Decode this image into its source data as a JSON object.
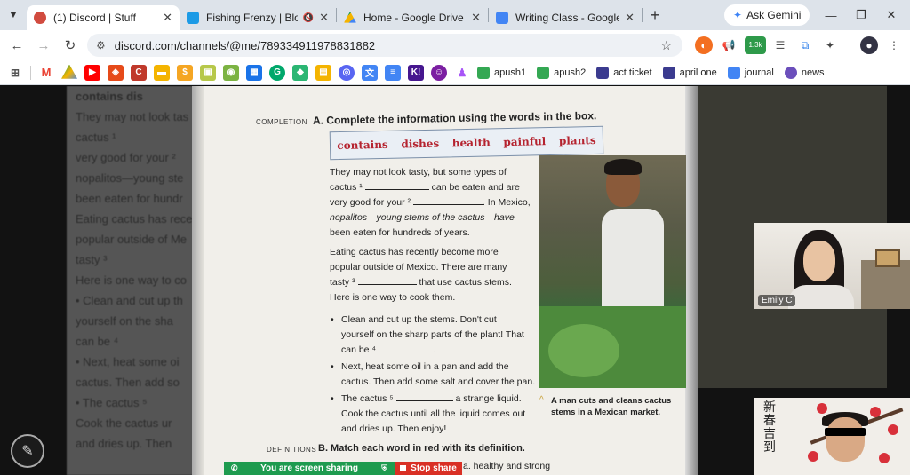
{
  "tabs": [
    {
      "title": "(1) Discord | Stuff",
      "active": true,
      "color": "#d14b3f"
    },
    {
      "title": "Fishing Frenzy | Blooket",
      "active": false,
      "color": "#1c9be6"
    },
    {
      "title": "Home - Google Drive",
      "active": false,
      "color": "#f4b400"
    },
    {
      "title": "Writing Class - Google Docs",
      "active": false,
      "color": "#4285f4"
    }
  ],
  "new_tab_label": "+",
  "gemini_label": "Ask Gemini",
  "address": {
    "url": "discord.com/channels/@me/789334911978831882"
  },
  "extensions": {
    "badge": "1.3k"
  },
  "bookmarks": [
    {
      "label": "apush1",
      "color": "#34a853"
    },
    {
      "label": "apush2",
      "color": "#34a853"
    },
    {
      "label": "act ticket",
      "color": "#3b3b8f"
    },
    {
      "label": "april one",
      "color": "#3b3b8f"
    },
    {
      "label": "journal",
      "color": "#4285f4"
    },
    {
      "label": "news",
      "color": "#6b4fbb"
    }
  ],
  "background_text": [
    "contains     dis",
    "They may not look tas",
    "cactus ¹",
    "very good for your ²",
    "nopalitos—young ste",
    "been eaten for hundr",
    "Eating cactus has rece",
    "popular outside of Me",
    "tasty ³",
    "Here is one way to co",
    "",
    "• Clean and cut up th",
    "  yourself on the sha",
    "  can be ⁴",
    "• Next, heat some oi",
    "  cactus. Then add so",
    "• The cactus ⁵",
    "  Cook the cactus ur",
    "  and dries up. Then"
  ],
  "book": {
    "completion_label": "COMPLETION",
    "instruction_a": "A.  Complete the information using the words in the box.",
    "words": [
      "contains",
      "dishes",
      "health",
      "painful",
      "plants"
    ],
    "para1": {
      "l1": "They may not look tasty, but some types of",
      "l2a": "cactus ¹",
      "l2b": "can be eaten and are",
      "l3a": "very good for your ²",
      "l3b": ". In Mexico,",
      "l4": "nopalitos—young stems of the cactus—have",
      "l5": "been eaten for hundreds of years."
    },
    "para2": {
      "l1": "Eating cactus has recently become more",
      "l2": "popular outside of Mexico. There are many",
      "l3a": "tasty ³",
      "l3b": "that use cactus stems.",
      "l4": "Here is one way to cook them."
    },
    "bullet1": {
      "l1": "Clean and cut up the stems. Don't cut",
      "l2": "yourself on the sharp parts of the plant! That",
      "l3a": "can be ⁴",
      "l3b": "."
    },
    "bullet2": {
      "l1": "Next, heat some oil in a pan and add the",
      "l2": "cactus. Then add some salt and cover the pan."
    },
    "bullet3": {
      "l1a": "The cactus ⁵",
      "l1b": "a strange liquid.",
      "l2": "Cook the cactus until all the liquid comes out",
      "l3": "and dries up. Then enjoy!"
    },
    "caption_l1": "A man cuts and cleans cactus",
    "caption_l2": "stems in a Mexican market.",
    "definitions_label": "DEFINITIONS",
    "instruction_b": "B.  Match each word in red with its definition.",
    "def_partial": "a.  healthy and strong"
  },
  "share": {
    "sharing_label": "You are screen sharing",
    "stop_label": "Stop share"
  },
  "participants": [
    {
      "name": "Emily C"
    }
  ],
  "calligraphy": "新 春 吉 到"
}
